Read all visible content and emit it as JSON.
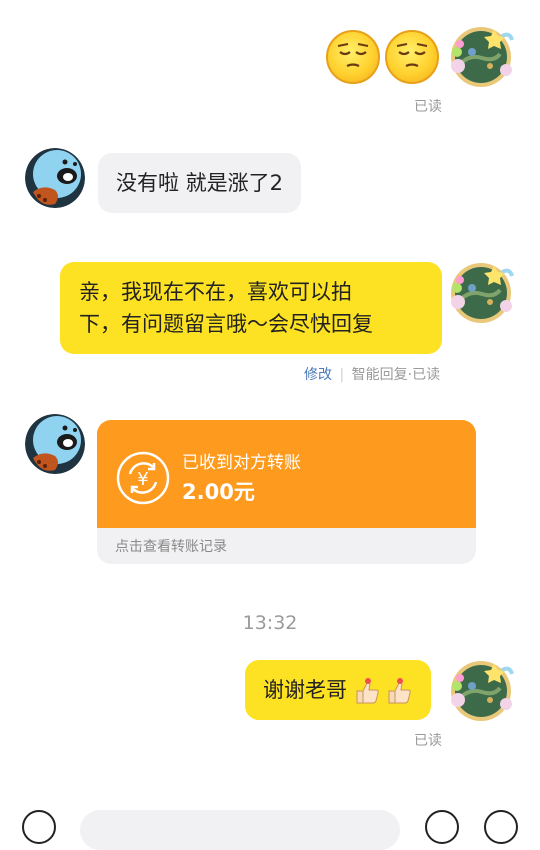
{
  "messages": {
    "m1": {
      "status": "已读"
    },
    "m2": {
      "text": "没有啦 就是涨了2"
    },
    "m3": {
      "line1": "亲，我现在不在，喜欢可以拍",
      "line2": "下，有问题留言哦～会尽快回复",
      "edit": "修改",
      "meta": "智能回复·已读"
    },
    "m4": {
      "title": "已收到对方转账",
      "amount": "2.00元",
      "footer": "点击查看转账记录",
      "symbol": "¥"
    },
    "time": "13:32",
    "m5": {
      "text": "谢谢老哥",
      "status": "已读"
    }
  },
  "colors": {
    "bubble_me": "#fde224",
    "bubble_other": "#f1f1f3",
    "transfer": "#fe9a1d",
    "link": "#4a7ab8"
  },
  "icons": [
    "sleepy-face-emoji",
    "thumbs-up-emoji",
    "yuan-exchange-icon"
  ]
}
